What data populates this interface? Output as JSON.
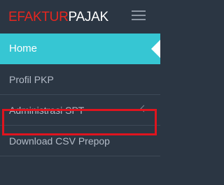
{
  "brand": {
    "part1": "EFAKTUR",
    "part2": "PAJAK"
  },
  "header": {
    "menu_icon": "hamburger-menu-icon"
  },
  "menu": {
    "items": [
      {
        "label": "Home",
        "active": true
      },
      {
        "label": "Profil PKP",
        "active": false
      },
      {
        "label": "Administrasi SPT",
        "active": false,
        "icon": "chevron-left-icon"
      },
      {
        "label": "Download CSV Prepop",
        "active": false,
        "highlighted": true
      }
    ]
  },
  "colors": {
    "sidebar_bg": "#2b3643",
    "active_bg": "#36c6d3",
    "brand_red": "#e5261f",
    "highlight_border": "#e0141e",
    "menu_text": "#b4bcc8"
  }
}
